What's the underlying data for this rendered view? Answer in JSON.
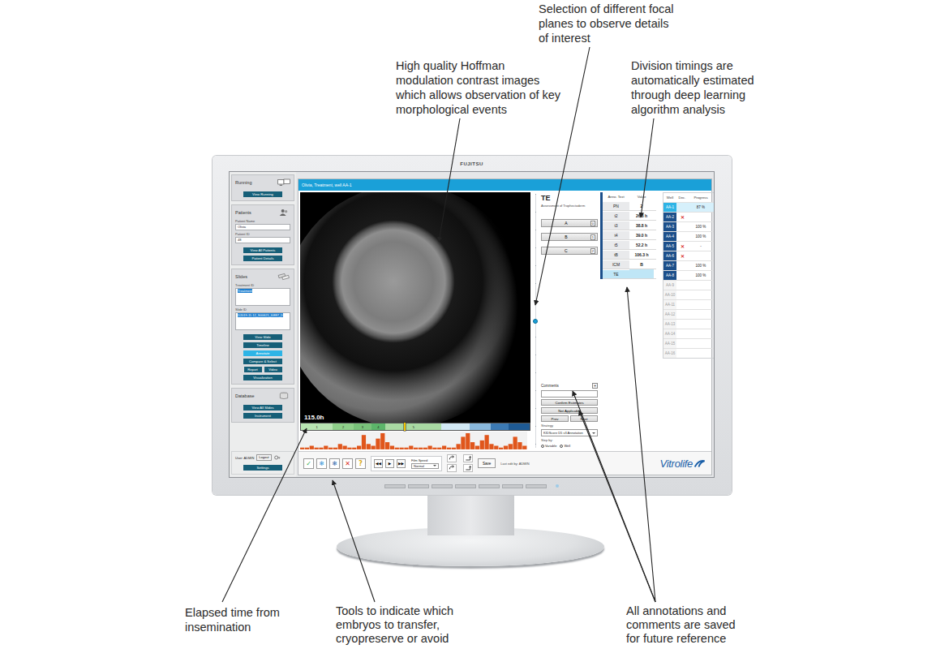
{
  "callouts": [
    {
      "text": "Selection of different focal planes to observe details of interest"
    },
    {
      "text": "High quality Hoffman modulation contrast images which allows observation of key morphological events"
    },
    {
      "text": "Division timings are automatically estimated through deep learning algorithm analysis"
    },
    {
      "text": "Elapsed time from insemination"
    },
    {
      "text": "Tools to indicate which embryos to transfer, cryopreserve or avoid"
    },
    {
      "text": "All annotations and comments are saved for future reference"
    }
  ],
  "monitor": {
    "brand": "FUJITSU"
  },
  "sidebar": {
    "sections": [
      {
        "title": "Running",
        "fields": [],
        "buttons": [
          {
            "label": "View Running",
            "selected": false
          }
        ]
      },
      {
        "title": "Patients",
        "fields": [
          {
            "label": "Patient Name",
            "value": "Olivia"
          },
          {
            "label": "Patient ID",
            "value": "48"
          }
        ],
        "buttons": [
          {
            "label": "View All Patients",
            "selected": false
          },
          {
            "label": "Patient Details",
            "selected": false
          }
        ]
      },
      {
        "title": "Slides",
        "fields": [
          {
            "label": "Treatment ID",
            "value": "Treatment"
          },
          {
            "label": "Slide ID",
            "value": "D2019.11.12_S00621_I0887_D"
          }
        ],
        "buttons": [
          {
            "label": "View Slide",
            "selected": false,
            "kind": "full"
          },
          {
            "label": "Timeline",
            "selected": false,
            "kind": "full"
          },
          {
            "label": "Annotate",
            "selected": true,
            "kind": "full"
          },
          {
            "label": "Compare & Select",
            "selected": false,
            "kind": "full"
          },
          {
            "label": "Report",
            "selected": false,
            "kind": "half"
          },
          {
            "label": "Video",
            "selected": false,
            "kind": "half"
          },
          {
            "label": "Visualization",
            "selected": false,
            "kind": "full"
          }
        ]
      },
      {
        "title": "Database",
        "fields": [],
        "buttons": [
          {
            "label": "View All Slides",
            "selected": false
          },
          {
            "label": "Instrument",
            "selected": false
          }
        ]
      }
    ],
    "user": {
      "label": "User: ADMIN",
      "logout": "Logout",
      "settings": "Settings"
    }
  },
  "main": {
    "title": "Olivia, Treatment, well AA-1",
    "image": {
      "time": "115.0h"
    },
    "timeline": {
      "marker_level": 0.45,
      "segments": [
        {
          "label": "1",
          "hours": 18,
          "color": "#b8e4b2"
        },
        {
          "label": "2",
          "hours": 12,
          "color": "#8fd08a"
        },
        {
          "label": "3",
          "hours": 10,
          "color": "#79c27a"
        },
        {
          "label": "4",
          "hours": 8,
          "color": "#5cb56a"
        },
        {
          "label": "5",
          "hours": 32,
          "color": "#a9d9a3"
        },
        {
          "hours": 16,
          "color": "#d3e9f5"
        },
        {
          "hours": 12,
          "color": "#8ab8dc"
        },
        {
          "hours": 10,
          "color": "#3c7ab4"
        },
        {
          "hours": 12,
          "color": "#1e5a94"
        }
      ]
    },
    "activity": [
      1,
      1,
      2,
      1,
      1,
      2,
      1,
      1,
      3,
      2,
      1,
      1,
      2,
      8,
      3,
      2,
      6,
      9,
      4,
      2,
      1,
      1,
      1,
      2,
      1,
      1,
      1,
      2,
      1,
      1,
      2,
      1,
      1,
      3,
      7,
      9,
      4,
      2,
      5,
      8,
      3,
      2,
      1,
      2,
      3,
      7,
      4,
      2
    ],
    "assessment": {
      "code": "TE",
      "name": "Assessment of Trophectoderm",
      "grades": [
        {
          "label": "A",
          "key": "0",
          "selected": false
        },
        {
          "label": "B",
          "key": "1",
          "selected": false
        },
        {
          "label": "C",
          "key": "2",
          "selected": false
        }
      ],
      "focus": {
        "level": 0.49
      },
      "comments": {
        "label": "Comments",
        "add": "+"
      },
      "actions": [
        "Confirm Estimates",
        "Not Applicable"
      ],
      "nav": [
        "Prev",
        "Next"
      ],
      "strategy": {
        "label": "Strategy",
        "value": "KIDScore D5 v3 Annotation"
      },
      "step": {
        "label": "Step by:",
        "options": [
          {
            "label": "Variable",
            "selected": true
          },
          {
            "label": "Well",
            "selected": false
          }
        ]
      }
    },
    "annotations": {
      "columns": [
        "Anno. Text",
        "Value"
      ],
      "rows": [
        {
          "name": "PN",
          "value": "2",
          "selected": false
        },
        {
          "name": "t2",
          "value": "26.8 h",
          "selected": false
        },
        {
          "name": "t3",
          "value": "38.8 h",
          "selected": false
        },
        {
          "name": "t4",
          "value": "39.0 h",
          "selected": false
        },
        {
          "name": "t5",
          "value": "52.2 h",
          "selected": false
        },
        {
          "name": "tB",
          "value": "106.3 h",
          "selected": false
        },
        {
          "name": "ICM",
          "value": "B",
          "selected": false
        },
        {
          "name": "TE",
          "value": "",
          "selected": true
        }
      ]
    },
    "wells": {
      "columns": [
        "Well",
        "Dec.",
        "Progress"
      ],
      "rows": [
        {
          "well": "AA-1",
          "progress": "87 %",
          "selected": true,
          "active": true
        },
        {
          "well": "AA-2",
          "decision": "✕",
          "selected": false,
          "active": true
        },
        {
          "well": "AA-3",
          "progress": "100 %",
          "selected": false,
          "active": true
        },
        {
          "well": "AA-4",
          "progress": "100 %",
          "selected": false,
          "active": true
        },
        {
          "well": "AA-5",
          "decision": "✕",
          "progress": "-",
          "selected": false,
          "active": true
        },
        {
          "well": "AA-6",
          "decision": "✕",
          "selected": false,
          "active": true
        },
        {
          "well": "AA-7",
          "progress": "100 %",
          "selected": false,
          "active": true
        },
        {
          "well": "AA-8",
          "progress": "100 %",
          "selected": false,
          "active": true
        },
        {
          "well": "AA-9",
          "selected": false,
          "active": false
        },
        {
          "well": "AA-10",
          "selected": false,
          "active": false
        },
        {
          "well": "AA-11",
          "selected": false,
          "active": false
        },
        {
          "well": "AA-12",
          "selected": false,
          "active": false
        },
        {
          "well": "AA-13",
          "selected": false,
          "active": false
        },
        {
          "well": "AA-14",
          "selected": false,
          "active": false
        },
        {
          "well": "AA-15",
          "selected": false,
          "active": false
        },
        {
          "well": "AA-16",
          "selected": false,
          "active": false
        }
      ]
    },
    "toolbar": {
      "decisions": [
        {
          "icon": "✓",
          "color": "#2fa84f"
        },
        {
          "icon": "❄",
          "color": "#2a8fd6"
        },
        {
          "icon": "❄",
          "color": "#1f5fa8"
        },
        {
          "icon": "✕",
          "color": "#d9322b"
        },
        {
          "icon": "?",
          "color": "#d9a917"
        }
      ],
      "playback": [
        "◀◀",
        "▶",
        "▶▶"
      ],
      "film_speed": {
        "label": "Film Speed",
        "value": "Normal"
      },
      "save": "Save",
      "last_edit": "Last edit by: ADMIN",
      "logo": "Vitrolife"
    }
  }
}
